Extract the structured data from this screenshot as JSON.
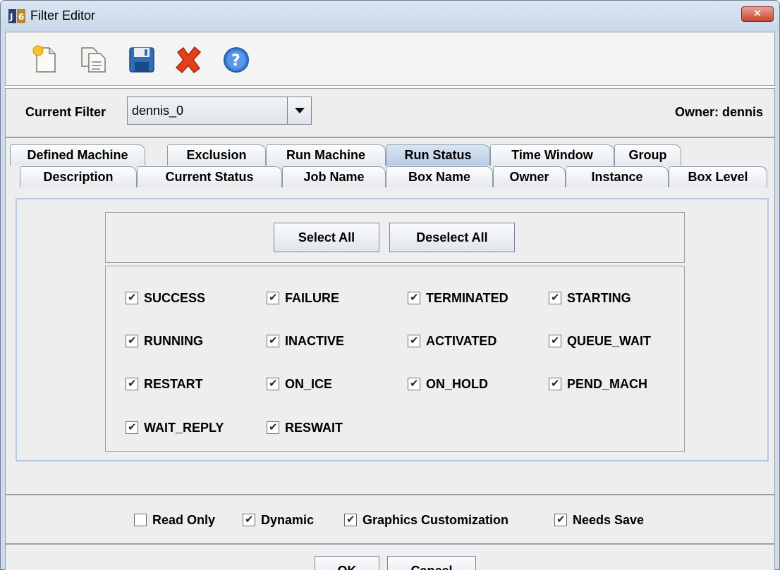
{
  "window": {
    "title": "Filter Editor",
    "close_label": "✕"
  },
  "toolbar": {
    "tools": [
      {
        "name": "new-filter-icon"
      },
      {
        "name": "copy-filter-icon"
      },
      {
        "name": "save-icon"
      },
      {
        "name": "delete-icon"
      },
      {
        "name": "help-icon"
      }
    ]
  },
  "filter": {
    "label": "Current Filter",
    "value": "dennis_0",
    "owner": "Owner: dennis"
  },
  "tabs": {
    "row1": [
      "Defined Machine",
      "Exclusion",
      "Run Machine",
      "Run Status",
      "Time Window",
      "Group"
    ],
    "row2": [
      "Description",
      "Current Status",
      "Job Name",
      "Box Name",
      "Owner",
      "Instance",
      "Box Level"
    ],
    "selected": "Run Status"
  },
  "panel": {
    "select_all": "Select All",
    "deselect_all": "Deselect All",
    "statuses": [
      {
        "label": "SUCCESS",
        "checked": true
      },
      {
        "label": "FAILURE",
        "checked": true
      },
      {
        "label": "TERMINATED",
        "checked": true
      },
      {
        "label": "STARTING",
        "checked": true
      },
      {
        "label": "RUNNING",
        "checked": true
      },
      {
        "label": "INACTIVE",
        "checked": true
      },
      {
        "label": "ACTIVATED",
        "checked": true
      },
      {
        "label": "QUEUE_WAIT",
        "checked": true
      },
      {
        "label": "RESTART",
        "checked": true
      },
      {
        "label": "ON_ICE",
        "checked": true
      },
      {
        "label": "ON_HOLD",
        "checked": true
      },
      {
        "label": "PEND_MACH",
        "checked": true
      },
      {
        "label": "WAIT_REPLY",
        "checked": true
      },
      {
        "label": "RESWAIT",
        "checked": true
      }
    ]
  },
  "options": [
    {
      "label": "Read Only",
      "checked": false
    },
    {
      "label": "Dynamic",
      "checked": true
    },
    {
      "label": "Graphics Customization",
      "checked": true
    },
    {
      "label": "Needs Save",
      "checked": true
    }
  ],
  "actions": {
    "ok": "OK",
    "cancel": "Cancel"
  }
}
